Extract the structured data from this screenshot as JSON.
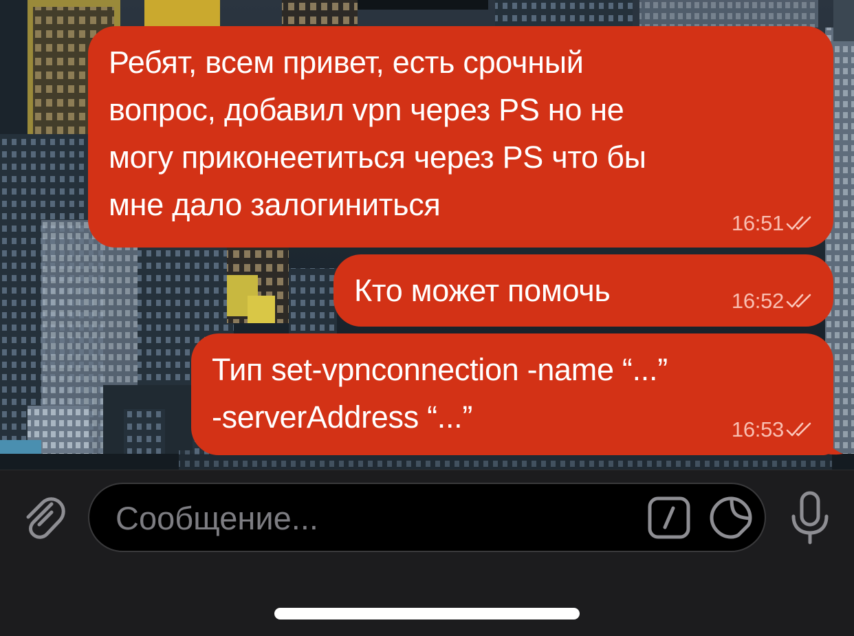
{
  "messages": [
    {
      "text": "Ребят, всем привет, есть срочный\nвопрос, добавил vpn через PS но не\nмогу приконеетиться через PS что бы\nмне дало залогиниться",
      "time": "16:51",
      "status": "read"
    },
    {
      "text": "Кто может помочь",
      "time": "16:52",
      "status": "read"
    },
    {
      "text": "Тип set-vpnconnection -name “...”\n-serverAddress “...”",
      "time": "16:53",
      "status": "read"
    }
  ],
  "composer": {
    "placeholder": "Сообщение...",
    "value": ""
  },
  "icons": {
    "attach": "paperclip-icon",
    "commands": "slash-command-icon",
    "sticker": "sticker-icon",
    "mic": "microphone-icon",
    "status": "double-check-icon"
  },
  "colors": {
    "outgoing_bubble": "#d33216",
    "input_bar": "#1c1c1e",
    "icon": "#8e8e93"
  }
}
